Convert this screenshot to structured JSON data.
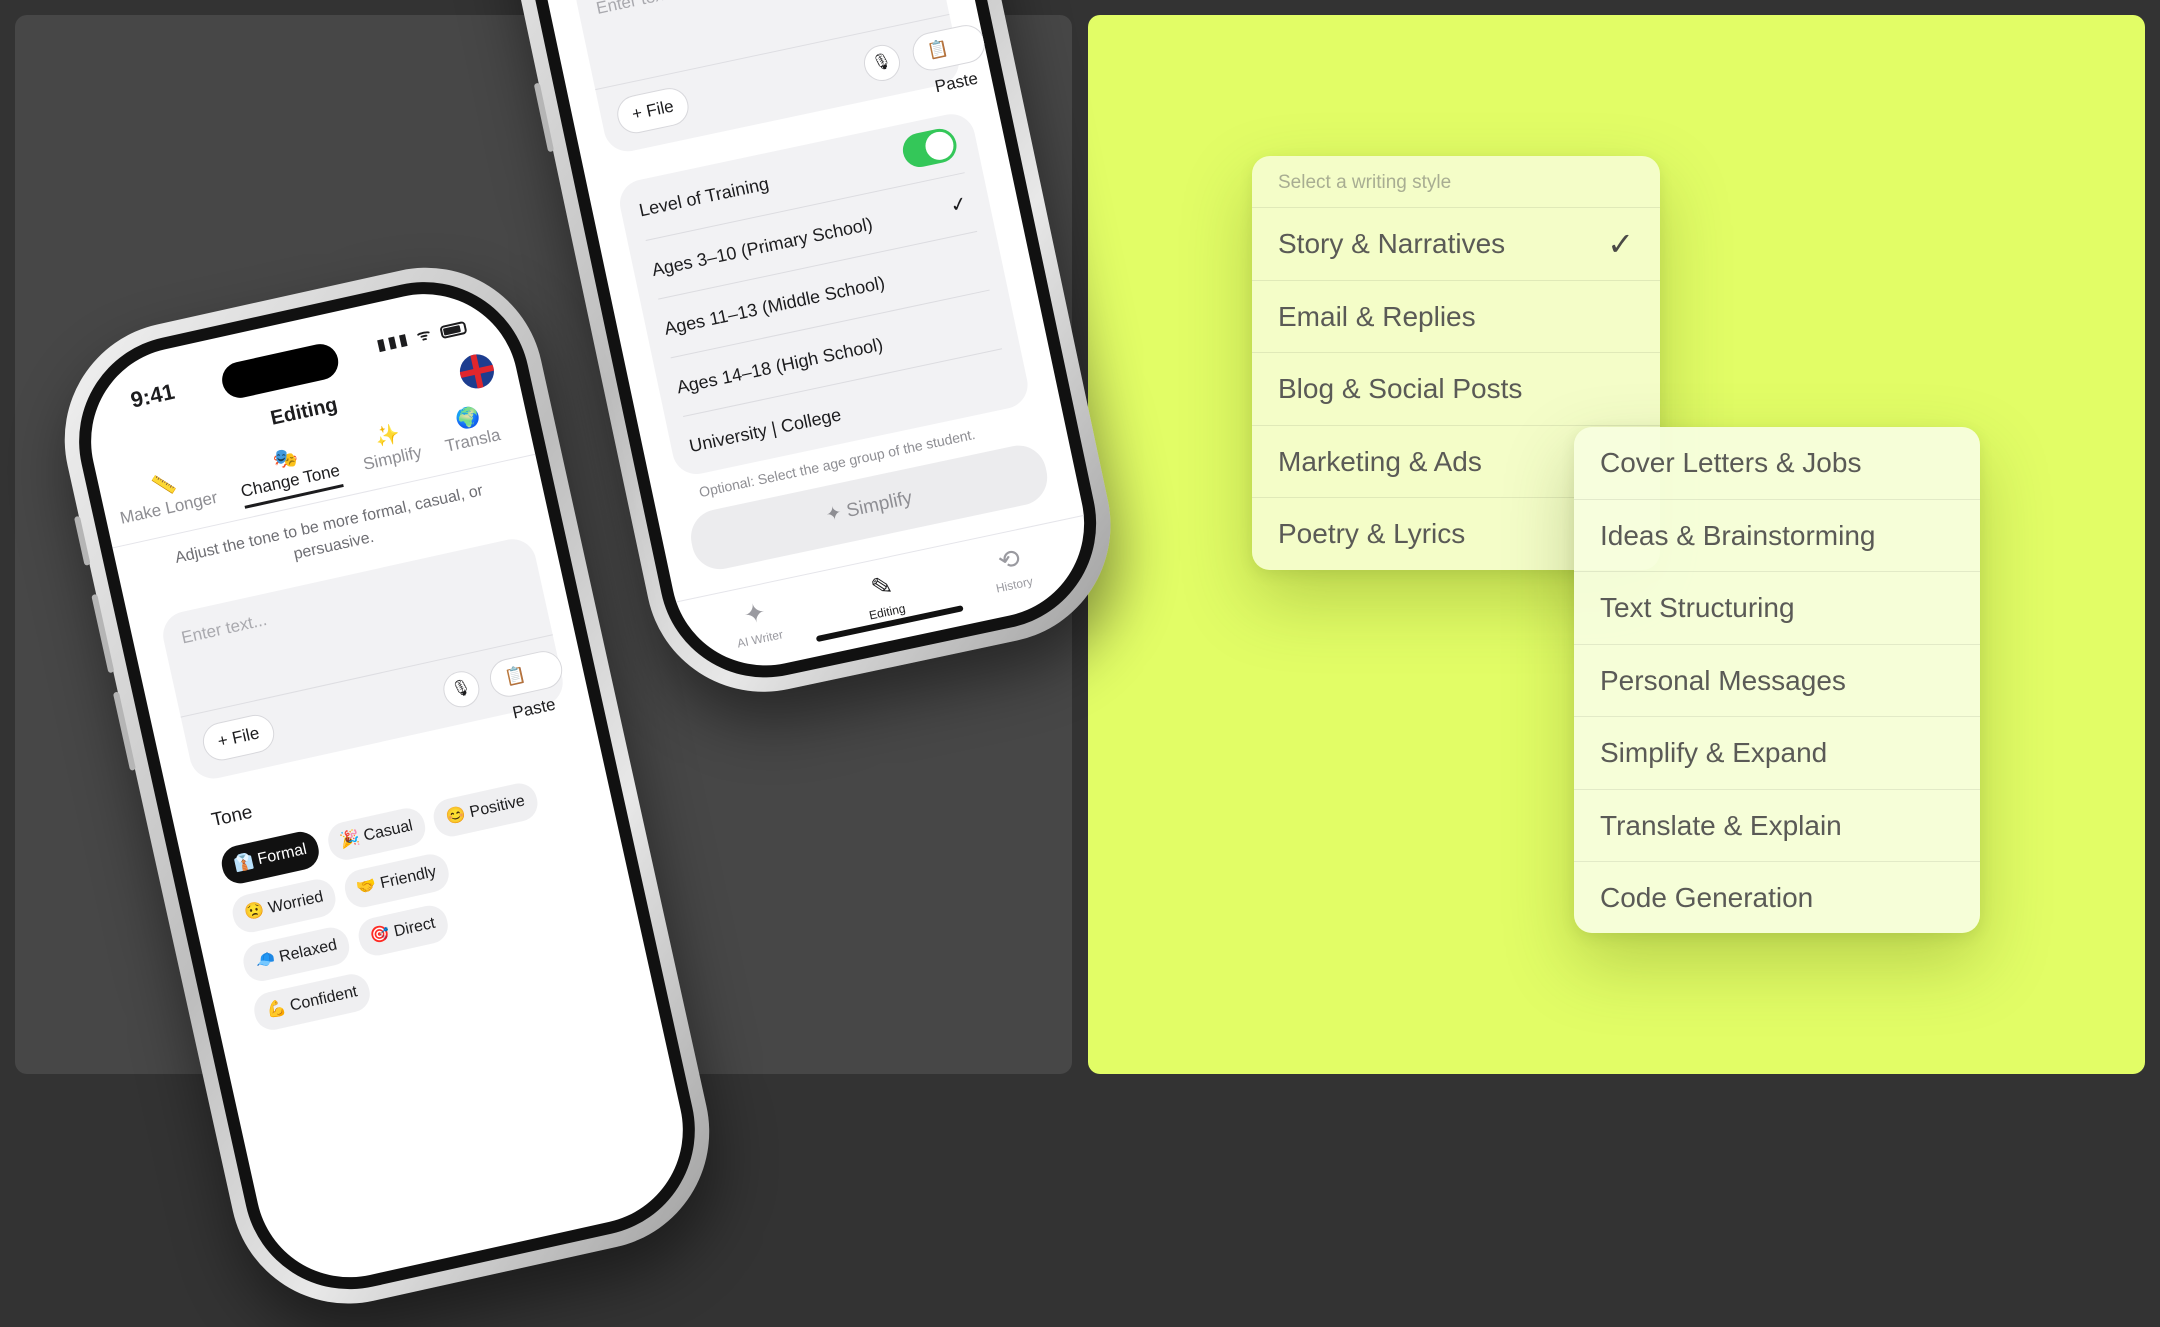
{
  "front_phone": {
    "time": "9:41",
    "status_icons": "▮▮▮ ᯤ",
    "nav_title": "Editing",
    "tools": [
      {
        "icon": "📏",
        "label": "Make Longer"
      },
      {
        "icon": "🎭",
        "label": "Change Tone"
      },
      {
        "icon": "✨",
        "label": "Simplify"
      },
      {
        "icon": "🌍",
        "label": "Transla"
      }
    ],
    "description": "Adjust the tone to be more formal, casual, or persuasive.",
    "input_placeholder": "Enter text...",
    "file_button": "+ File",
    "mic_icon": "🎙",
    "paste_button": "📋 Paste",
    "tone_label": "Tone",
    "tones": [
      {
        "label": "👔 Formal",
        "selected": true
      },
      {
        "label": "🎉 Casual",
        "selected": false
      },
      {
        "label": "😊 Positive",
        "selected": false
      },
      {
        "label": "😟 Worried",
        "selected": false
      },
      {
        "label": "🤝 Friendly",
        "selected": false
      },
      {
        "label": "🧢 Relaxed",
        "selected": false
      },
      {
        "label": "🎯 Direct",
        "selected": false
      },
      {
        "label": "💪 Confident",
        "selected": false
      }
    ]
  },
  "back_phone": {
    "input_placeholder": "Enter text...",
    "file_button": "+ File",
    "mic_icon": "🎙",
    "paste_button": "📋 Paste",
    "level_label": "Level of Training",
    "level_enabled": true,
    "levels": [
      {
        "label": "Ages 3–10 (Primary School)",
        "checked": true
      },
      {
        "label": "Ages 11–13 (Middle School)",
        "checked": false
      },
      {
        "label": "Ages 14–18 (High School)",
        "checked": false
      },
      {
        "label": "University | College",
        "checked": false
      }
    ],
    "hint": "Optional: Select the age group of the student.",
    "action_button": "✦ Simplify",
    "tabs": [
      {
        "icon": "✦",
        "label": "AI Writer",
        "active": false
      },
      {
        "icon": "✎",
        "label": "Editing",
        "active": true
      },
      {
        "icon": "⟲",
        "label": "History",
        "active": false
      }
    ]
  },
  "style_menu": {
    "header": "Select a writing style",
    "items": [
      {
        "label": "Story & Narratives",
        "checked": true
      },
      {
        "label": "Email & Replies",
        "checked": false
      },
      {
        "label": "Blog & Social Posts",
        "checked": false
      },
      {
        "label": "Marketing & Ads",
        "checked": false
      },
      {
        "label": "Poetry & Lyrics",
        "checked": false
      }
    ],
    "check_mark": "✓"
  },
  "style_submenu": {
    "items": [
      {
        "label": "Cover Letters & Jobs"
      },
      {
        "label": "Ideas & Brainstorming"
      },
      {
        "label": "Text Structuring"
      },
      {
        "label": "Personal Messages"
      },
      {
        "label": "Simplify & Expand"
      },
      {
        "label": "Translate & Explain"
      },
      {
        "label": "Code Generation"
      }
    ]
  },
  "colors": {
    "background": "#333333",
    "left_panel": "#474747",
    "right_panel": "#e2fd66",
    "toggle_on": "#34c759",
    "selected_chip": "#111111"
  }
}
